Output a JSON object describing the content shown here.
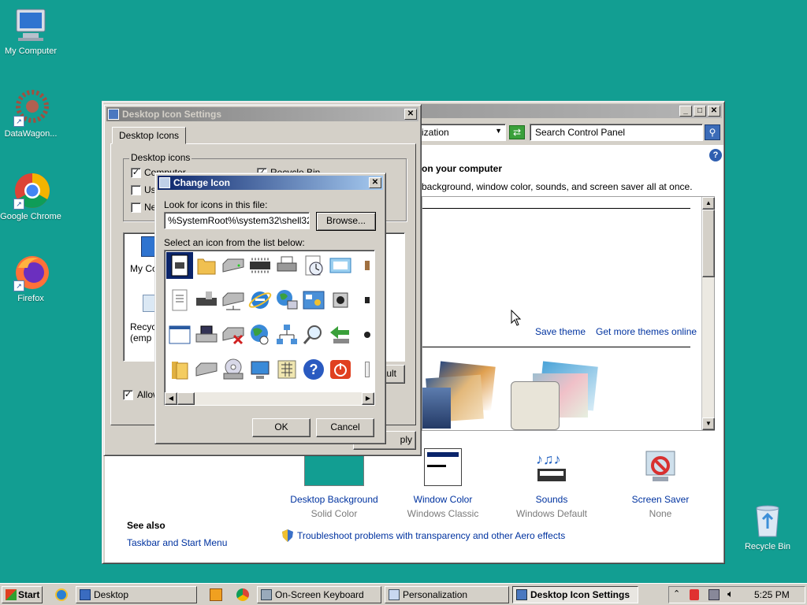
{
  "desktop": {
    "icons": [
      {
        "label": "My Computer",
        "icon": "my-computer-icon"
      },
      {
        "label": "DataWagon...",
        "icon": "datawagon-icon"
      },
      {
        "label": "Google Chrome",
        "icon": "chrome-icon"
      },
      {
        "label": "Firefox",
        "icon": "firefox-icon"
      },
      {
        "label": "Recycle Bin",
        "icon": "recycle-bin-icon"
      }
    ]
  },
  "personalization": {
    "address": "ization",
    "search_placeholder": "Search Control Panel",
    "heading": "on your computer",
    "subtext": "background, window color, sounds, and screen saver all at once.",
    "save_theme": "Save theme",
    "more_themes": "Get more themes online",
    "items": [
      {
        "label": "Desktop Background",
        "value": "Solid Color"
      },
      {
        "label": "Window Color",
        "value": "Windows Classic"
      },
      {
        "label": "Sounds",
        "value": "Windows Default"
      },
      {
        "label": "Screen Saver",
        "value": "None"
      }
    ],
    "see_also": "See also",
    "taskbar_link": "Taskbar and Start Menu",
    "troubleshoot": "Troubleshoot problems with transparency and other Aero effects"
  },
  "desktop_icon_settings": {
    "title": "Desktop Icon Settings",
    "tab": "Desktop Icons",
    "group": "Desktop icons",
    "checkboxes": [
      {
        "label": "Computer",
        "checked": true
      },
      {
        "label": "Us",
        "checked": false
      },
      {
        "label": "Ne",
        "checked": false
      },
      {
        "label": "Recycle Bin",
        "checked": true
      }
    ],
    "list_items": [
      "My Co",
      "Recyc\n(emp"
    ],
    "default_btn": "ault",
    "allow_label": "Allow",
    "apply_btn": "ply"
  },
  "change_icon": {
    "title": "Change Icon",
    "look_label": "Look for icons in this file:",
    "file_path": "%SystemRoot%\\system32\\shell32.d",
    "browse": "Browse...",
    "select_label": "Select an icon from the list below:",
    "ok": "OK",
    "cancel": "Cancel"
  },
  "taskbar": {
    "start": "Start",
    "items": [
      "Desktop",
      "On-Screen Keyboard",
      "Personalization",
      "Desktop Icon Settings"
    ],
    "time": "5:25 PM"
  },
  "colors": {
    "desktop": "#129e92",
    "title_active": "#0a246a",
    "link": "#0033a0"
  }
}
